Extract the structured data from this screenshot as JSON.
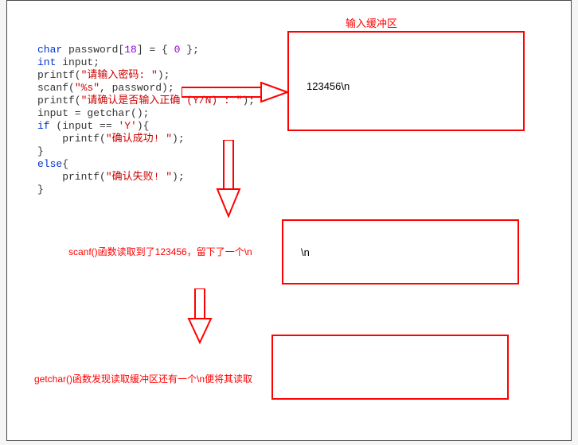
{
  "code": {
    "line1_kw": "char",
    "line1_rest": " password[",
    "line1_num": "18",
    "line1_tail": "] = { ",
    "line1_zero": "0",
    "line1_end": " };",
    "line2_kw": "int",
    "line2_rest": " input;",
    "line3a": "printf(",
    "line3_str": "\"请输入密码: \"",
    "line3b": ");",
    "line4a": "scanf(",
    "line4_str": "\"%s\"",
    "line4b": ", password);",
    "line5a": "printf(",
    "line5_str": "\"请确认是否输入正确 (Y/N) : \"",
    "line5b": ");",
    "line6": "input = getchar();",
    "line7a_kw": "if",
    "line7a_rest": " (input == ",
    "line7_char": "'Y'",
    "line7b": "){",
    "line8a": "    printf(",
    "line8_str": "\"确认成功! \"",
    "line8b": ");",
    "line9": "}",
    "line10_kw": "else",
    "line10_rest": "{",
    "line11a": "    printf(",
    "line11_str": "\"确认失败! \"",
    "line11b": ");",
    "line12": "}"
  },
  "buffer_title": "输入缓冲区",
  "buffer1_content": "123456\\n",
  "buffer2_content": "\\n",
  "caption1": "scanf()函数读取到了123456，留下了一个\\n",
  "caption2": "getchar()函数发现读取缓冲区还有一个\\n便将其读取"
}
